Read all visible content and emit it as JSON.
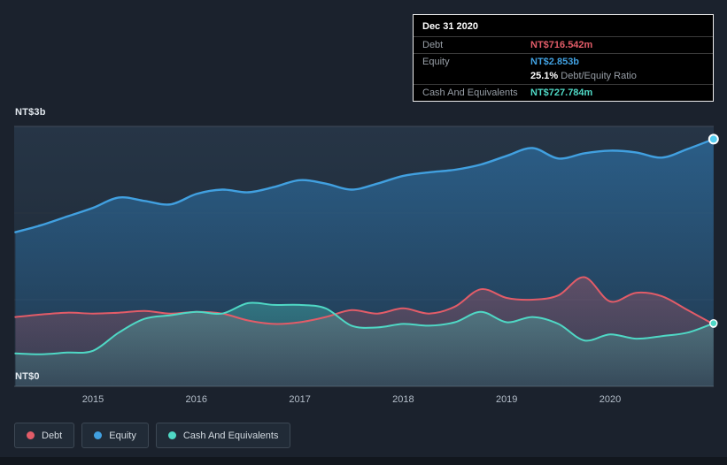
{
  "colors": {
    "debt": "#e25c68",
    "equity": "#41a0e0",
    "equity_dot": "#55cdf0",
    "cash": "#4fd8c5",
    "background": "#1b222d",
    "tooltip_bg": "#000000"
  },
  "tooltip": {
    "date": "Dec 31 2020",
    "debt_label": "Debt",
    "debt_value": "NT$716.542m",
    "equity_label": "Equity",
    "equity_value": "NT$2.853b",
    "ratio_value": "25.1%",
    "ratio_label": "Debt/Equity Ratio",
    "cash_label": "Cash And Equivalents",
    "cash_value": "NT$727.784m"
  },
  "axis": {
    "y_top": "NT$3b",
    "y_bottom": "NT$0",
    "x_ticks": [
      "2015",
      "2016",
      "2017",
      "2018",
      "2019",
      "2020"
    ]
  },
  "legend": [
    {
      "name": "debt",
      "label": "Debt",
      "color_key": "debt"
    },
    {
      "name": "equity",
      "label": "Equity",
      "color_key": "equity"
    },
    {
      "name": "cash-and-equivalents",
      "label": "Cash And Equivalents",
      "color_key": "cash"
    }
  ],
  "chart_data": {
    "type": "area",
    "unit": "NT$ billions",
    "ylim": [
      0,
      3
    ],
    "xlim": [
      2014.25,
      2021.0
    ],
    "grid": "horizontal",
    "legend_position": "bottom-left",
    "x_tick_years": [
      2015,
      2016,
      2017,
      2018,
      2019,
      2020
    ],
    "y_tick_labels": {
      "top": "NT$3b",
      "bottom": "NT$0"
    },
    "x": [
      2014.25,
      2014.5,
      2014.75,
      2015.0,
      2015.25,
      2015.5,
      2015.75,
      2016.0,
      2016.25,
      2016.5,
      2016.75,
      2017.0,
      2017.25,
      2017.5,
      2017.75,
      2018.0,
      2018.25,
      2018.5,
      2018.75,
      2019.0,
      2019.25,
      2019.5,
      2019.75,
      2020.0,
      2020.25,
      2020.5,
      2020.75,
      2021.0
    ],
    "series": [
      {
        "name": "Equity",
        "color_key": "equity",
        "last_value_label": "NT$2.853b",
        "values": [
          1.78,
          1.86,
          1.96,
          2.06,
          2.18,
          2.14,
          2.1,
          2.22,
          2.27,
          2.24,
          2.3,
          2.38,
          2.34,
          2.27,
          2.34,
          2.43,
          2.47,
          2.5,
          2.56,
          2.66,
          2.75,
          2.63,
          2.69,
          2.72,
          2.7,
          2.64,
          2.74,
          2.853
        ]
      },
      {
        "name": "Debt",
        "color_key": "debt",
        "last_value_label": "NT$716.542m",
        "values": [
          0.8,
          0.83,
          0.85,
          0.84,
          0.85,
          0.87,
          0.84,
          0.86,
          0.84,
          0.76,
          0.72,
          0.74,
          0.8,
          0.88,
          0.84,
          0.9,
          0.84,
          0.92,
          1.12,
          1.02,
          1.0,
          1.05,
          1.26,
          0.98,
          1.08,
          1.04,
          0.88,
          0.7165
        ]
      },
      {
        "name": "Cash And Equivalents",
        "color_key": "cash",
        "last_value_label": "NT$727.784m",
        "values": [
          0.38,
          0.37,
          0.39,
          0.41,
          0.62,
          0.78,
          0.82,
          0.86,
          0.84,
          0.96,
          0.94,
          0.94,
          0.9,
          0.7,
          0.68,
          0.72,
          0.7,
          0.74,
          0.86,
          0.74,
          0.8,
          0.72,
          0.53,
          0.6,
          0.55,
          0.58,
          0.62,
          0.7278
        ]
      }
    ]
  }
}
